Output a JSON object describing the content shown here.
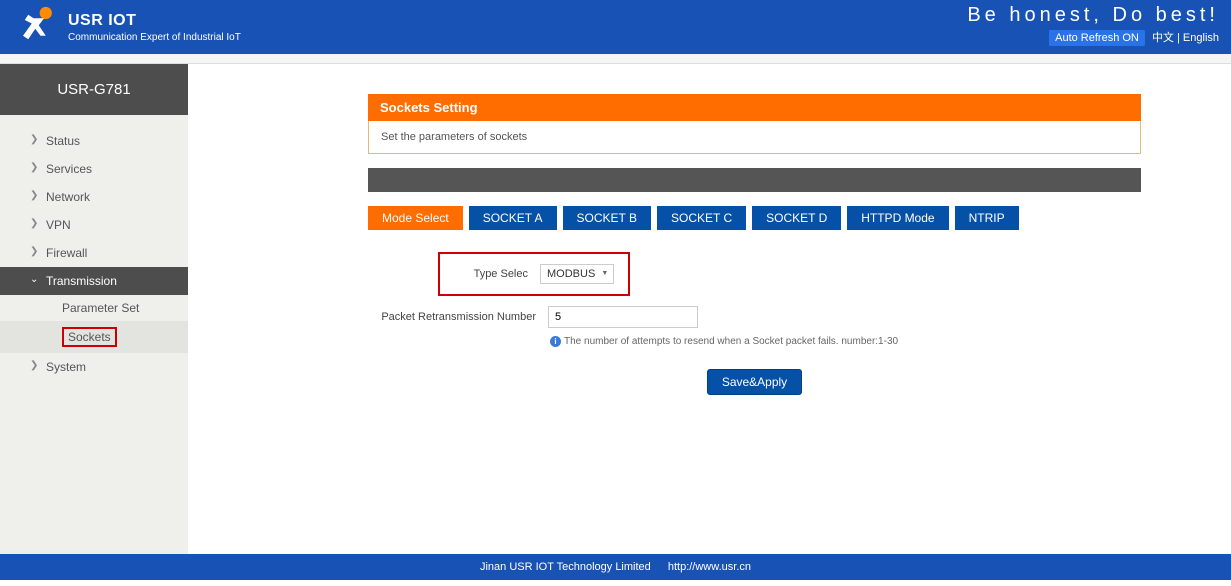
{
  "header": {
    "brand_title": "USR IOT",
    "brand_sub": "Communication Expert of Industrial IoT",
    "slogan": "Be honest, Do best!",
    "auto_refresh": "Auto Refresh ON",
    "lang_cn": "中文",
    "lang_sep": " | ",
    "lang_en": "English"
  },
  "device": {
    "name": "USR-G781"
  },
  "nav": {
    "items": [
      {
        "label": "Status",
        "expanded": false
      },
      {
        "label": "Services",
        "expanded": false
      },
      {
        "label": "Network",
        "expanded": false
      },
      {
        "label": "VPN",
        "expanded": false
      },
      {
        "label": "Firewall",
        "expanded": false
      },
      {
        "label": "Transmission",
        "expanded": true,
        "children": [
          {
            "label": "Parameter Set",
            "active": false
          },
          {
            "label": "Sockets",
            "active": true
          }
        ]
      },
      {
        "label": "System",
        "expanded": false
      }
    ]
  },
  "panel": {
    "title": "Sockets Setting",
    "desc": "Set the parameters of sockets"
  },
  "tabs": [
    {
      "label": "Mode Select",
      "active": true
    },
    {
      "label": "SOCKET A"
    },
    {
      "label": "SOCKET B"
    },
    {
      "label": "SOCKET C"
    },
    {
      "label": "SOCKET D"
    },
    {
      "label": "HTTPD Mode"
    },
    {
      "label": "NTRIP"
    }
  ],
  "form": {
    "type_select_label": "Type Selec",
    "type_select_value": "MODBUS",
    "retrans_label": "Packet Retransmission Number",
    "retrans_value": "5",
    "retrans_hint": "The number of attempts to resend when a Socket packet fails. number:1-30",
    "save_label": "Save&Apply"
  },
  "footer": {
    "company": "Jinan USR IOT Technology Limited",
    "url": "http://www.usr.cn"
  }
}
